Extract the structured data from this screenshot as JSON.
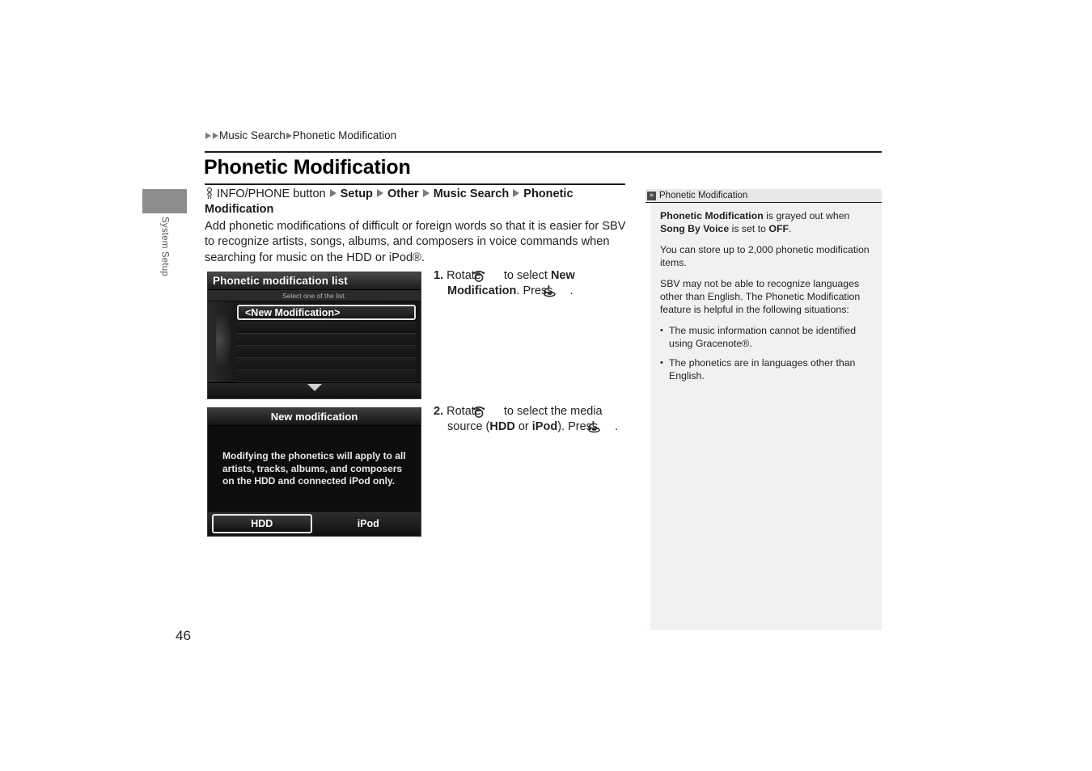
{
  "sidebar_tab": {
    "label": "System Setup",
    "block_color": "#8d8d8d"
  },
  "breadcrumb": {
    "item1": "Music Search",
    "item2": "Phonetic Modification"
  },
  "page_title": "Phonetic Modification",
  "nav_path": {
    "button": "INFO/PHONE button",
    "step1": "Setup",
    "step2": "Other",
    "step3": "Music Search",
    "step4": "Phonetic",
    "step4b": "Modification"
  },
  "intro": "Add phonetic modifications of difficult or foreign words so that it is easier for SBV to recognize artists, songs, albums, and composers in voice commands when searching for music on the HDD or iPod®.",
  "figures": {
    "fig1": {
      "title": "Phonetic modification list",
      "subtitle": "Select one of the list.",
      "selected_item": "<New Modification>",
      "empty_rows": 5
    },
    "fig2": {
      "title": "New modification",
      "message": "Modifying the phonetics will apply to all artists, tracks, albums, and composers on the HDD and connected iPod only.",
      "button_hdd": "HDD",
      "button_ipod": "iPod"
    }
  },
  "steps": [
    {
      "number": "1.",
      "t1": "Rotate ",
      "icon1": "rotary-dial-icon",
      "t2": " to select ",
      "b1": "New Modification",
      "t3": ". Press ",
      "icon2": "press-knob-icon",
      "t4": "."
    },
    {
      "number": "2.",
      "t1": "Rotate ",
      "icon1": "rotary-dial-icon",
      "t2": " to select the media source (",
      "b1": "HDD",
      "t3": " or ",
      "b2": "iPod",
      "t4": "). Press ",
      "icon2": "press-knob-icon",
      "t5": "."
    }
  ],
  "note_panel": {
    "header_icon": "»",
    "header_title": "Phonetic Modification",
    "p1_b1": "Phonetic Modification",
    "p1_t1": " is grayed out when ",
    "p1_b2": "Song By Voice",
    "p1_t2": " is set to ",
    "p1_b3": "OFF",
    "p1_t3": ".",
    "p2": "You can store up to 2,000 phonetic modification items.",
    "p3": "SBV may not be able to recognize languages other than English. The Phonetic Modification feature is helpful in the following situations:",
    "bullet1": "The music information cannot be identified using Gracenote®.",
    "bullet2": "The phonetics are in languages other than English.",
    "bullet_char": "•"
  },
  "page_number": "46",
  "colors": {
    "panel_bg": "#f1f1f1",
    "panel_header_bg": "#e8e8e8",
    "tab_gray": "#8d8d8d",
    "rule": "#1a1a1a",
    "text": "#231f20"
  }
}
